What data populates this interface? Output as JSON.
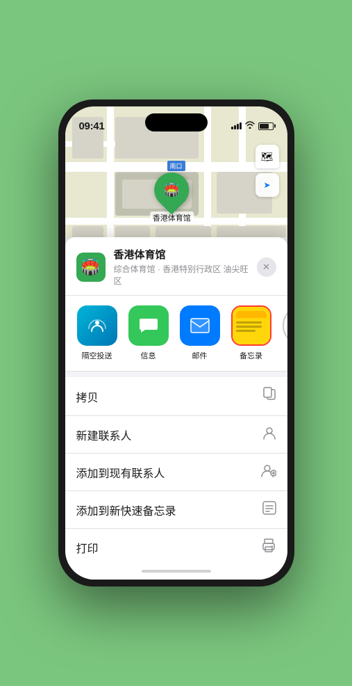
{
  "status_bar": {
    "time": "09:41",
    "signal_label": "signal",
    "wifi_label": "wifi",
    "battery_label": "battery"
  },
  "map": {
    "label_sign": "南口",
    "pin_label": "香港体育馆",
    "pin_emoji": "🏟️"
  },
  "map_controls": {
    "map_type_icon": "🗺",
    "location_icon": "➤"
  },
  "venue": {
    "name": "香港体育馆",
    "subtitle": "综合体育馆 · 香港特别行政区 油尖旺区",
    "icon_emoji": "🏟️",
    "close_icon": "✕"
  },
  "share_actions": [
    {
      "id": "airdrop",
      "label": "隔空投送",
      "type": "airdrop"
    },
    {
      "id": "messages",
      "label": "信息",
      "type": "messages"
    },
    {
      "id": "mail",
      "label": "邮件",
      "type": "mail"
    },
    {
      "id": "notes",
      "label": "备忘录",
      "type": "notes"
    }
  ],
  "action_items": [
    {
      "id": "copy",
      "label": "拷贝",
      "icon": "⎘"
    },
    {
      "id": "new-contact",
      "label": "新建联系人",
      "icon": "👤"
    },
    {
      "id": "add-existing",
      "label": "添加到现有联系人",
      "icon": "👤"
    },
    {
      "id": "quick-note",
      "label": "添加到新快速备忘录",
      "icon": "⬜"
    },
    {
      "id": "print",
      "label": "打印",
      "icon": "🖨"
    }
  ]
}
